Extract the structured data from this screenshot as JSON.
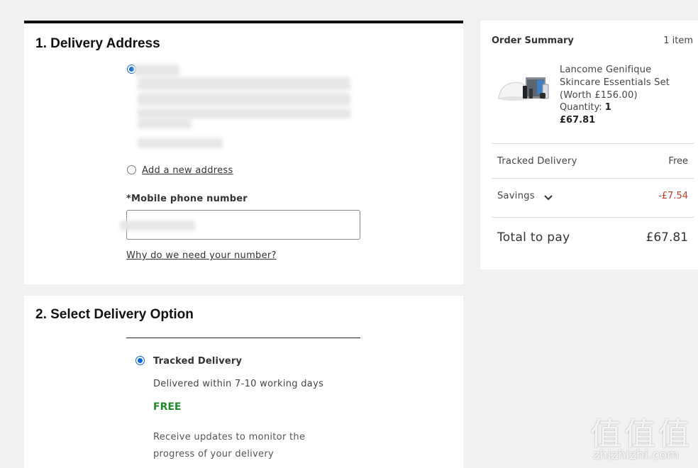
{
  "delivery_address": {
    "title": "1. Delivery Address",
    "add_new_label": "Add a new address",
    "phone_label": "*Mobile phone number",
    "why_link": "Why do we need your number?"
  },
  "delivery_option": {
    "title": "2. Select Delivery Option",
    "option_name": "Tracked Delivery",
    "option_desc": "Delivered within 7-10 working days",
    "option_price": "FREE",
    "option_note": "Receive updates to monitor the progress of your delivery"
  },
  "order_summary": {
    "title": "Order Summary",
    "item_count": "1 item",
    "product": {
      "name": "Lancome Genifique Skincare Essentials Set (Worth £156.00)",
      "quantity_label": "Quantity:",
      "quantity": "1",
      "price": "£67.81"
    },
    "delivery_label": "Tracked Delivery",
    "delivery_value": "Free",
    "savings_label": "Savings",
    "savings_value": "-£7.54",
    "total_label": "Total to pay",
    "total_value": "£67.81"
  },
  "watermark": {
    "glyph": "值",
    "text": "zhizhizhi.com"
  },
  "colors": {
    "accent_radio": "#0a66d8",
    "free_green": "#1f8a2a",
    "savings_red": "#c0392b"
  }
}
